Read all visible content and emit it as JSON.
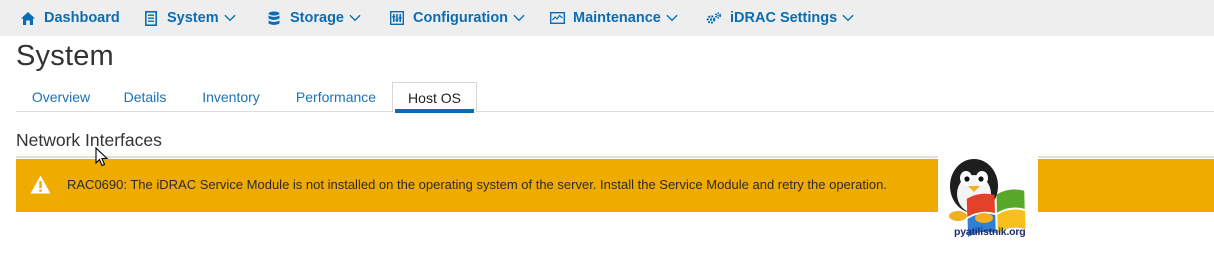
{
  "topnav": {
    "items": [
      {
        "label": "Dashboard",
        "icon": "home-icon",
        "has_dropdown": false
      },
      {
        "label": "System",
        "icon": "server-icon",
        "has_dropdown": true
      },
      {
        "label": "Storage",
        "icon": "database-icon",
        "has_dropdown": true
      },
      {
        "label": "Configuration",
        "icon": "configuration-icon",
        "has_dropdown": true
      },
      {
        "label": "Maintenance",
        "icon": "monitor-icon",
        "has_dropdown": true
      },
      {
        "label": "iDRAC Settings",
        "icon": "gears-icon",
        "has_dropdown": true
      }
    ],
    "link_color": "#0a6db3",
    "background": "#eeeeee"
  },
  "page": {
    "title": "System"
  },
  "tabs": {
    "items": [
      "Overview",
      "Details",
      "Inventory",
      "Performance",
      "Host OS"
    ],
    "active": "Host OS",
    "active_underline_color": "#0a6db3"
  },
  "section": {
    "heading": "Network Interfaces"
  },
  "alert": {
    "icon": "warning-icon",
    "message": "RAC0690: The iDRAC Service Module is not installed on the operating system of the server. Install the Service Module and retry the operation.",
    "background": "#f0ab00"
  },
  "watermark": {
    "text": "pyatilistnik.org"
  }
}
